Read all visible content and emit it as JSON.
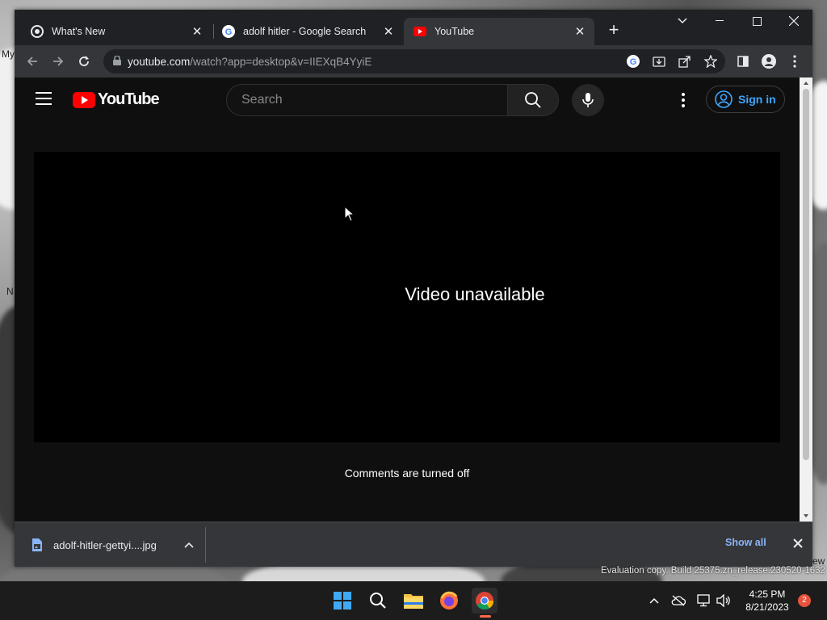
{
  "desktop": {
    "labels": [
      "My",
      "N",
      "ew"
    ]
  },
  "browser": {
    "tabs": [
      {
        "title": "What's New",
        "favicon": "chrome-icon",
        "active": false
      },
      {
        "title": "adolf hitler - Google Search",
        "favicon": "google-icon",
        "active": false
      },
      {
        "title": "YouTube",
        "favicon": "youtube-icon",
        "active": true
      }
    ],
    "new_tab_label": "+",
    "address": {
      "domain": "youtube.com",
      "path": "/watch?app=desktop&v=IIEXqB4YyiE"
    }
  },
  "youtube": {
    "logo_text": "YouTube",
    "search_placeholder": "Search",
    "sign_in_label": "Sign in",
    "player_message": "Video unavailable",
    "comments_message": "Comments are turned off",
    "colors": {
      "brand_red": "#ff0000",
      "link_blue": "#3ea6ff",
      "page_bg": "#0f0f0f"
    }
  },
  "downloads": {
    "filename": "adolf-hitler-gettyi....jpg",
    "show_all_label": "Show all"
  },
  "watermark": "Evaluation copy. Build 25375.zn_release.230520-1632",
  "taskbar": {
    "time": "4:25 PM",
    "date": "8/21/2023",
    "notification_count": "2",
    "apps": [
      "start-icon",
      "search-icon",
      "file-explorer-icon",
      "firefox-icon",
      "chrome-icon"
    ]
  }
}
